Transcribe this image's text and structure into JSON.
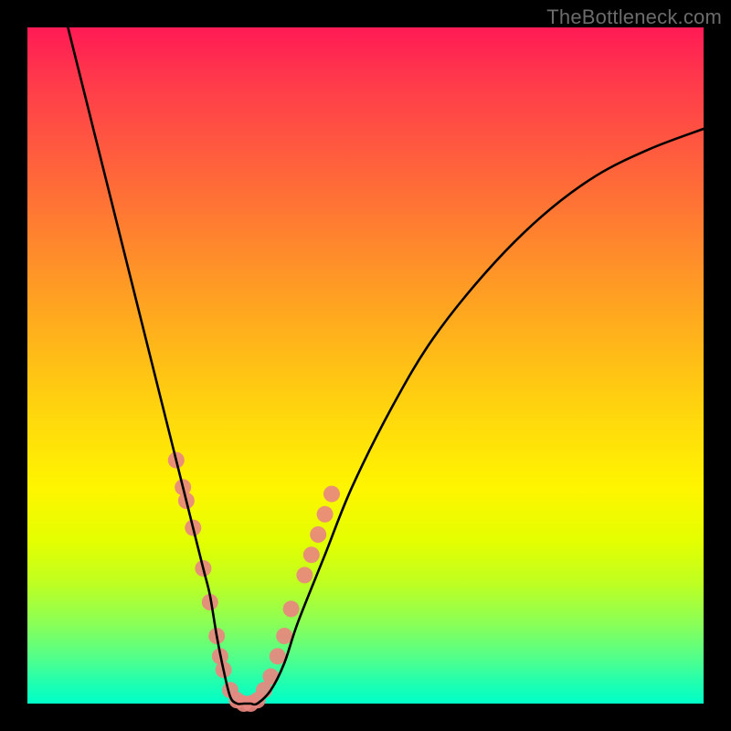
{
  "watermark": "TheBottleneck.com",
  "chart_data": {
    "type": "line",
    "title": "",
    "xlabel": "",
    "ylabel": "",
    "xlim": [
      0,
      100
    ],
    "ylim": [
      0,
      100
    ],
    "grid": false,
    "legend": false,
    "background": "rainbow-gradient-red-to-green",
    "series": [
      {
        "name": "bottleneck-curve",
        "color": "#000000",
        "x": [
          6,
          8,
          10,
          12,
          14,
          16,
          18,
          20,
          22,
          24,
          26,
          27,
          28,
          29,
          30,
          31,
          32,
          33,
          34,
          36,
          38,
          40,
          44,
          48,
          54,
          60,
          68,
          76,
          84,
          92,
          100
        ],
        "y": [
          100,
          92,
          84,
          76,
          68,
          60,
          52,
          44,
          36,
          28,
          20,
          16,
          10,
          5,
          1,
          0,
          0,
          0,
          0,
          2,
          6,
          12,
          22,
          32,
          44,
          54,
          64,
          72,
          78,
          82,
          85
        ]
      }
    ],
    "markers": [
      {
        "name": "highlight-dots",
        "color": "#e8877f",
        "radius_px": 9,
        "points": [
          {
            "x": 22,
            "y": 36
          },
          {
            "x": 23,
            "y": 32
          },
          {
            "x": 23.5,
            "y": 30
          },
          {
            "x": 24.5,
            "y": 26
          },
          {
            "x": 26,
            "y": 20
          },
          {
            "x": 27,
            "y": 15
          },
          {
            "x": 28,
            "y": 10
          },
          {
            "x": 28.5,
            "y": 7
          },
          {
            "x": 29,
            "y": 5
          },
          {
            "x": 30,
            "y": 2
          },
          {
            "x": 31,
            "y": 0.5
          },
          {
            "x": 32,
            "y": 0
          },
          {
            "x": 33,
            "y": 0
          },
          {
            "x": 34,
            "y": 0.5
          },
          {
            "x": 35,
            "y": 2
          },
          {
            "x": 36,
            "y": 4
          },
          {
            "x": 37,
            "y": 7
          },
          {
            "x": 38,
            "y": 10
          },
          {
            "x": 39,
            "y": 14
          },
          {
            "x": 41,
            "y": 19
          },
          {
            "x": 42,
            "y": 22
          },
          {
            "x": 43,
            "y": 25
          },
          {
            "x": 44,
            "y": 28
          },
          {
            "x": 45,
            "y": 31
          }
        ]
      }
    ]
  }
}
